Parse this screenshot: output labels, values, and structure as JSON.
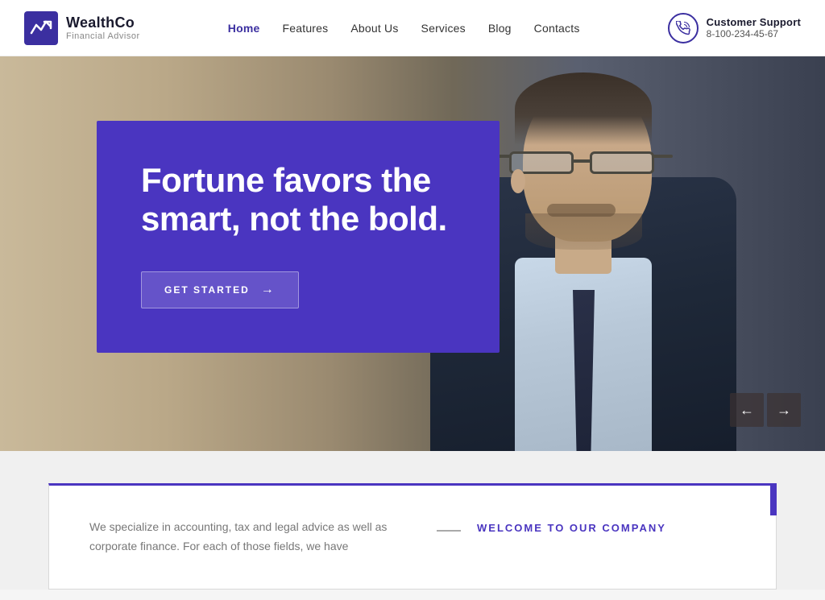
{
  "header": {
    "logo": {
      "name": "WealthCo",
      "subtitle": "Financial Advisor"
    },
    "nav": {
      "items": [
        {
          "label": "Home",
          "active": true
        },
        {
          "label": "Features",
          "active": false
        },
        {
          "label": "About Us",
          "active": false
        },
        {
          "label": "Services",
          "active": false
        },
        {
          "label": "Blog",
          "active": false
        },
        {
          "label": "Contacts",
          "active": false
        }
      ]
    },
    "support": {
      "label": "Customer Support",
      "phone": "8-100-234-45-67"
    }
  },
  "hero": {
    "headline": "Fortune favors the smart, not the bold.",
    "cta_label": "GET STARTED",
    "slider_prev": "←",
    "slider_next": "→"
  },
  "bottom": {
    "welcome_label": "WELCOME TO OUR COMPANY",
    "description": "We specialize in accounting, tax and legal advice as well as corporate finance. For each of those fields, we have"
  }
}
